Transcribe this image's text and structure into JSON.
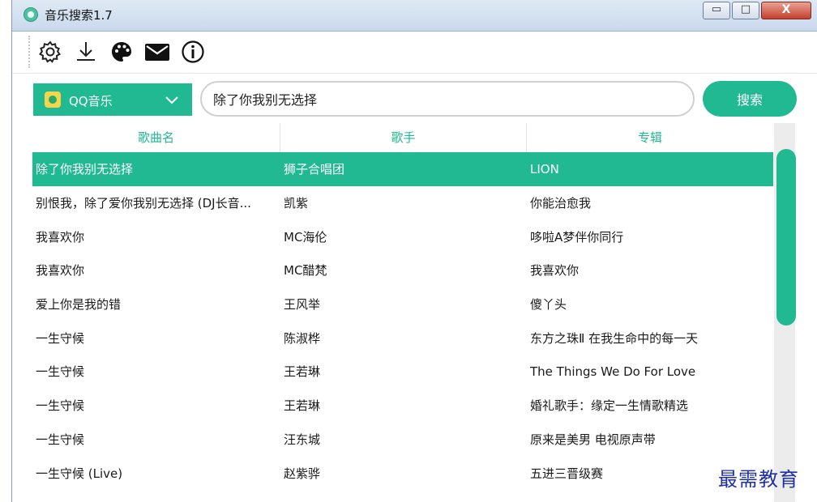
{
  "window": {
    "title": "音乐搜索1.7",
    "controls": {
      "minimize": "▭",
      "maximize": "□",
      "close": "X"
    }
  },
  "toolbar": {
    "icons": [
      "settings-icon",
      "download-icon",
      "palette-icon",
      "mail-icon",
      "info-icon"
    ]
  },
  "search": {
    "source": "QQ音乐",
    "query": "除了你我别无选择",
    "button": "搜索"
  },
  "table": {
    "columns": [
      "歌曲名",
      "歌手",
      "专辑"
    ],
    "rows": [
      {
        "song": "除了你我别无选择",
        "artist": "狮子合唱团",
        "album": "LION",
        "selected": true
      },
      {
        "song": "别恨我，除了爱你我别无选择 (DJ长音...",
        "artist": "凯紫",
        "album": "你能治愈我"
      },
      {
        "song": "我喜欢你",
        "artist": "MC海伦",
        "album": "哆啦A梦伴你同行"
      },
      {
        "song": "我喜欢你",
        "artist": "MC醋梵",
        "album": "我喜欢你"
      },
      {
        "song": "爱上你是我的错",
        "artist": "王风举",
        "album": "傻丫头"
      },
      {
        "song": "一生守候",
        "artist": "陈淑桦",
        "album": "东方之珠Ⅱ 在我生命中的每一天"
      },
      {
        "song": "一生守候",
        "artist": "王若琳",
        "album": "The Things We Do For Love"
      },
      {
        "song": "一生守候",
        "artist": "王若琳",
        "album": "婚礼歌手：缘定一生情歌精选"
      },
      {
        "song": "一生守候",
        "artist": "汪东城",
        "album": "原来是美男 电视原声带"
      },
      {
        "song": "一生守候 (Live)",
        "artist": "赵紫骅",
        "album": "五进三晋级赛"
      }
    ]
  },
  "colors": {
    "accent": "#21b991",
    "watermark": "#1f2fa8"
  },
  "watermark": "最需教育"
}
